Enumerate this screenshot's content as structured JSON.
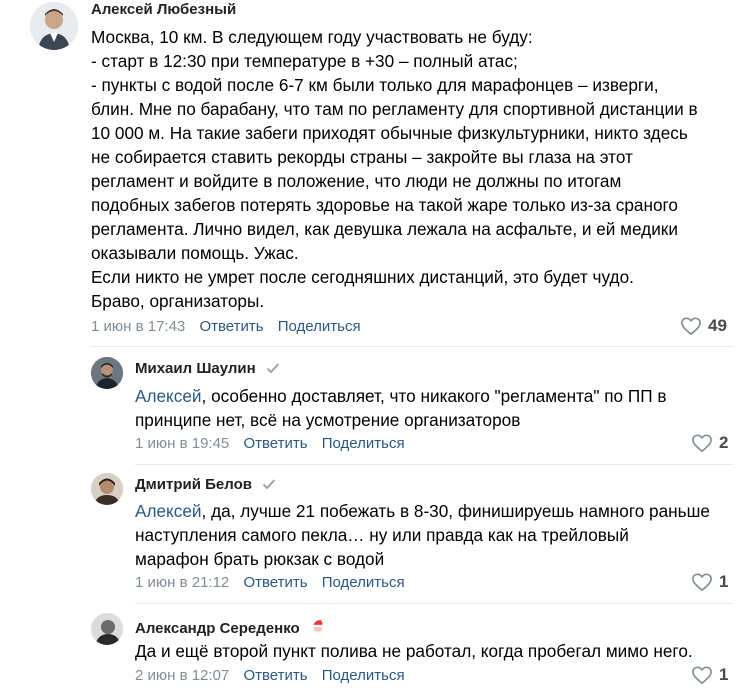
{
  "comments": [
    {
      "author": "Алексей Любезный",
      "lines": [
        "Москва, 10 км. В следующем году участвовать не буду:",
        "- старт в 12:30 при температуре в +30 – полный атас;",
        "- пункты с водой после 6-7 км были только для марафонцев – изверги,",
        "блин. Мне по барабану, что там по регламенту для спортивной дистанции в",
        "10 000 м. На такие забеги приходят обычные физкультурники, никто здесь",
        "не собирается ставить рекорды страны – закройте вы глаза на этот",
        "регламент и войдите в положение, что люди не должны по итогам",
        "подобных забегов потерять здоровье на такой жаре только из-за сраного",
        "регламента. Лично видел, как девушка лежала на асфальте, и ей медики",
        "оказывали помощь. Ужас.",
        "Если никто не умрет после сегодняшних дистанций, это будет чудо.",
        "Браво, организаторы."
      ],
      "date": "1 июн в 17:43",
      "reply_label": "Ответить",
      "share_label": "Поделиться",
      "likes": "49"
    },
    {
      "author": "Михаил Шаулин",
      "mention": "Алексей",
      "line1_rest": ", особенно доставляет, что никакого \"регламента\" по ПП в",
      "line2": "принципе нет, всё на усмотрение организаторов",
      "date": "1 июн в 19:45",
      "reply_label": "Ответить",
      "share_label": "Поделиться",
      "likes": "2"
    },
    {
      "author": "Дмитрий Белов",
      "mention": "Алексей",
      "line1_rest": ", да, лучше 21 побежать в 8-30, финишируешь намного раньше",
      "line2": "наступления самого пекла… ну или правда как на трейловый",
      "line3": "марафон брать рюкзак с водой",
      "date": "1 июн в 21:12",
      "reply_label": "Ответить",
      "share_label": "Поделиться",
      "likes": "1"
    },
    {
      "author": "Александр Середенко",
      "line1": "Да и ещё второй пункт полива не работал, когда пробегал мимо него.",
      "date": "2 июн в 12:07",
      "reply_label": "Ответить",
      "share_label": "Поделиться",
      "likes": "1"
    }
  ],
  "colors": {
    "link": "#2a5885",
    "meta": "#818c99",
    "separator": "#e7e8ec"
  },
  "icons": [
    "heart-icon",
    "verified-check-icon",
    "santa-emoji-icon"
  ]
}
